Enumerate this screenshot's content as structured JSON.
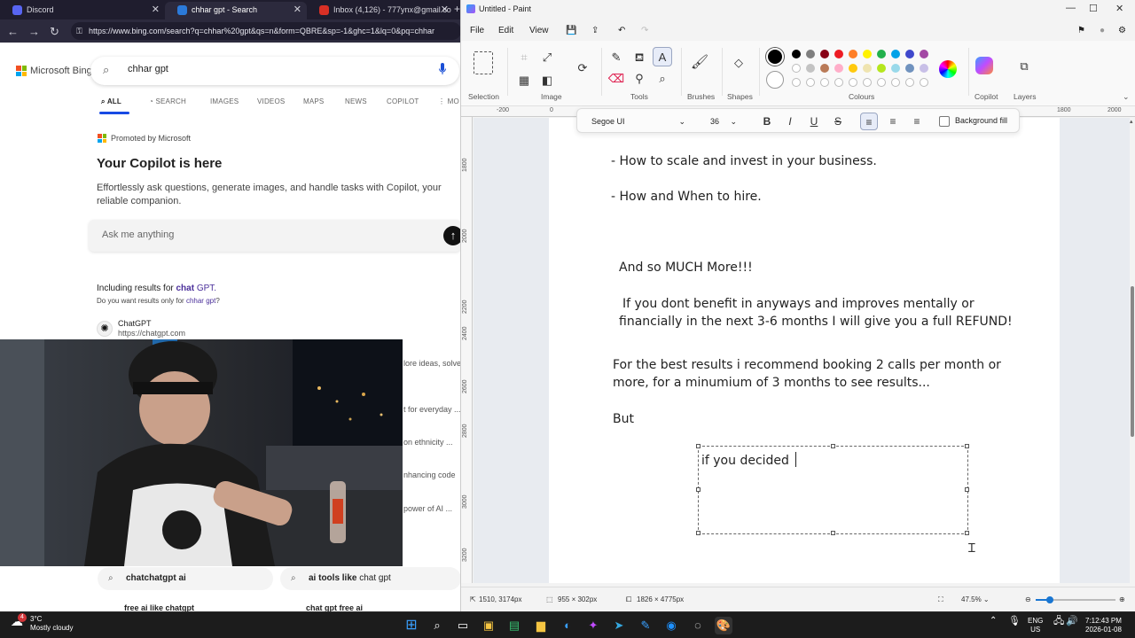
{
  "browser": {
    "tabs": [
      {
        "label": "Discord",
        "active": false
      },
      {
        "label": "chhar gpt - Search",
        "active": true
      },
      {
        "label": "Inbox (4,126) - 777ynx@gmail.co",
        "active": false
      }
    ],
    "url": "https://www.bing.com/search?q=chhar%20gpt&qs=n&form=QBRE&sp=-1&ghc=1&lq=0&pq=chhar",
    "logo": "Microsoft Bing",
    "search_query": "chhar gpt",
    "search_tabs": [
      "ALL",
      "SEARCH",
      "IMAGES",
      "VIDEOS",
      "MAPS",
      "NEWS",
      "COPILOT",
      "MO"
    ],
    "promoted": "Promoted by Microsoft",
    "copilot_heading": "Your Copilot is here",
    "copilot_desc": "Effortlessly ask questions, generate images, and handle tasks with Copilot, your reliable companion.",
    "ask_placeholder": "Ask me anything",
    "including_prefix": "Including results for",
    "including_bold": "chat",
    "including_suffix": " GPT.",
    "do_you_want_prefix": "Do you want results only for",
    "do_you_want_link": "chhar gpt",
    "do_you_want_suffix": "?",
    "result_title": "ChatGPT",
    "result_url": "https://chatgpt.com",
    "snippets": [
      "lore ideas, solve",
      "t for everyday ...",
      "on ethnicity ...",
      "nhancing code",
      "power of AI ..."
    ],
    "related": [
      {
        "prefix": "chatchatgpt ai",
        "bold": "",
        "suffix": ""
      },
      {
        "prefix": "ai tools like ",
        "bold": "chat",
        "suffix": " gpt"
      }
    ],
    "related_cut": [
      "free ai like chatgpt",
      "chat gpt free ai"
    ]
  },
  "paint": {
    "title": "Untitled - Paint",
    "menu": [
      "File",
      "Edit",
      "View"
    ],
    "groups": [
      "Selection",
      "Image",
      "Tools",
      "Brushes",
      "Shapes",
      "Colours",
      "Copilot",
      "Layers"
    ],
    "font_name": "Segoe UI",
    "font_size": "36",
    "background_fill": "Background fill",
    "ruler_h": [
      "-200",
      "0",
      "1800",
      "2000"
    ],
    "ruler_v": [
      "1800",
      "2000",
      "2200",
      "2400",
      "2600",
      "2800",
      "3000",
      "3200"
    ],
    "canvas_lines": [
      "- How to scale and invest in your business.",
      "- How and When to hire.",
      "And so MUCH More!!!",
      "If you dont benefit in anyways and improves mentally or",
      "financially in the next 3-6 months I will give you a full REFUND!",
      "For the best results i recommend booking 2 calls per month or",
      "more, for a minumium  of 3 months to see results...",
      "But"
    ],
    "typing_text": "if you decided ",
    "status": {
      "cursor": "1510, 3174px",
      "selection": "955 × 302px",
      "canvas_size": "1826 × 4775px",
      "zoom": "47.5%"
    },
    "zoom_fraction": 0.18,
    "colors_row1": [
      "#000000",
      "#7f7f7f",
      "#880015",
      "#ed1c24",
      "#ff7f27",
      "#fff200",
      "#22b14c",
      "#00a2e8",
      "#3f48cc",
      "#a349a4"
    ],
    "colors_row2": [
      "#ffffff",
      "#c3c3c3",
      "#b97a57",
      "#ffaec9",
      "#ffc90e",
      "#efe4b0",
      "#b5e61d",
      "#99d9ea",
      "#7092be",
      "#c8bfe7"
    ]
  },
  "taskbar": {
    "weather_temp": "3°C",
    "weather_desc": "Mostly cloudy",
    "notif_count": "4",
    "lang_top": "ENG",
    "lang_bottom": "US",
    "time": "7:12:43 PM",
    "date": "2026-01-08"
  }
}
